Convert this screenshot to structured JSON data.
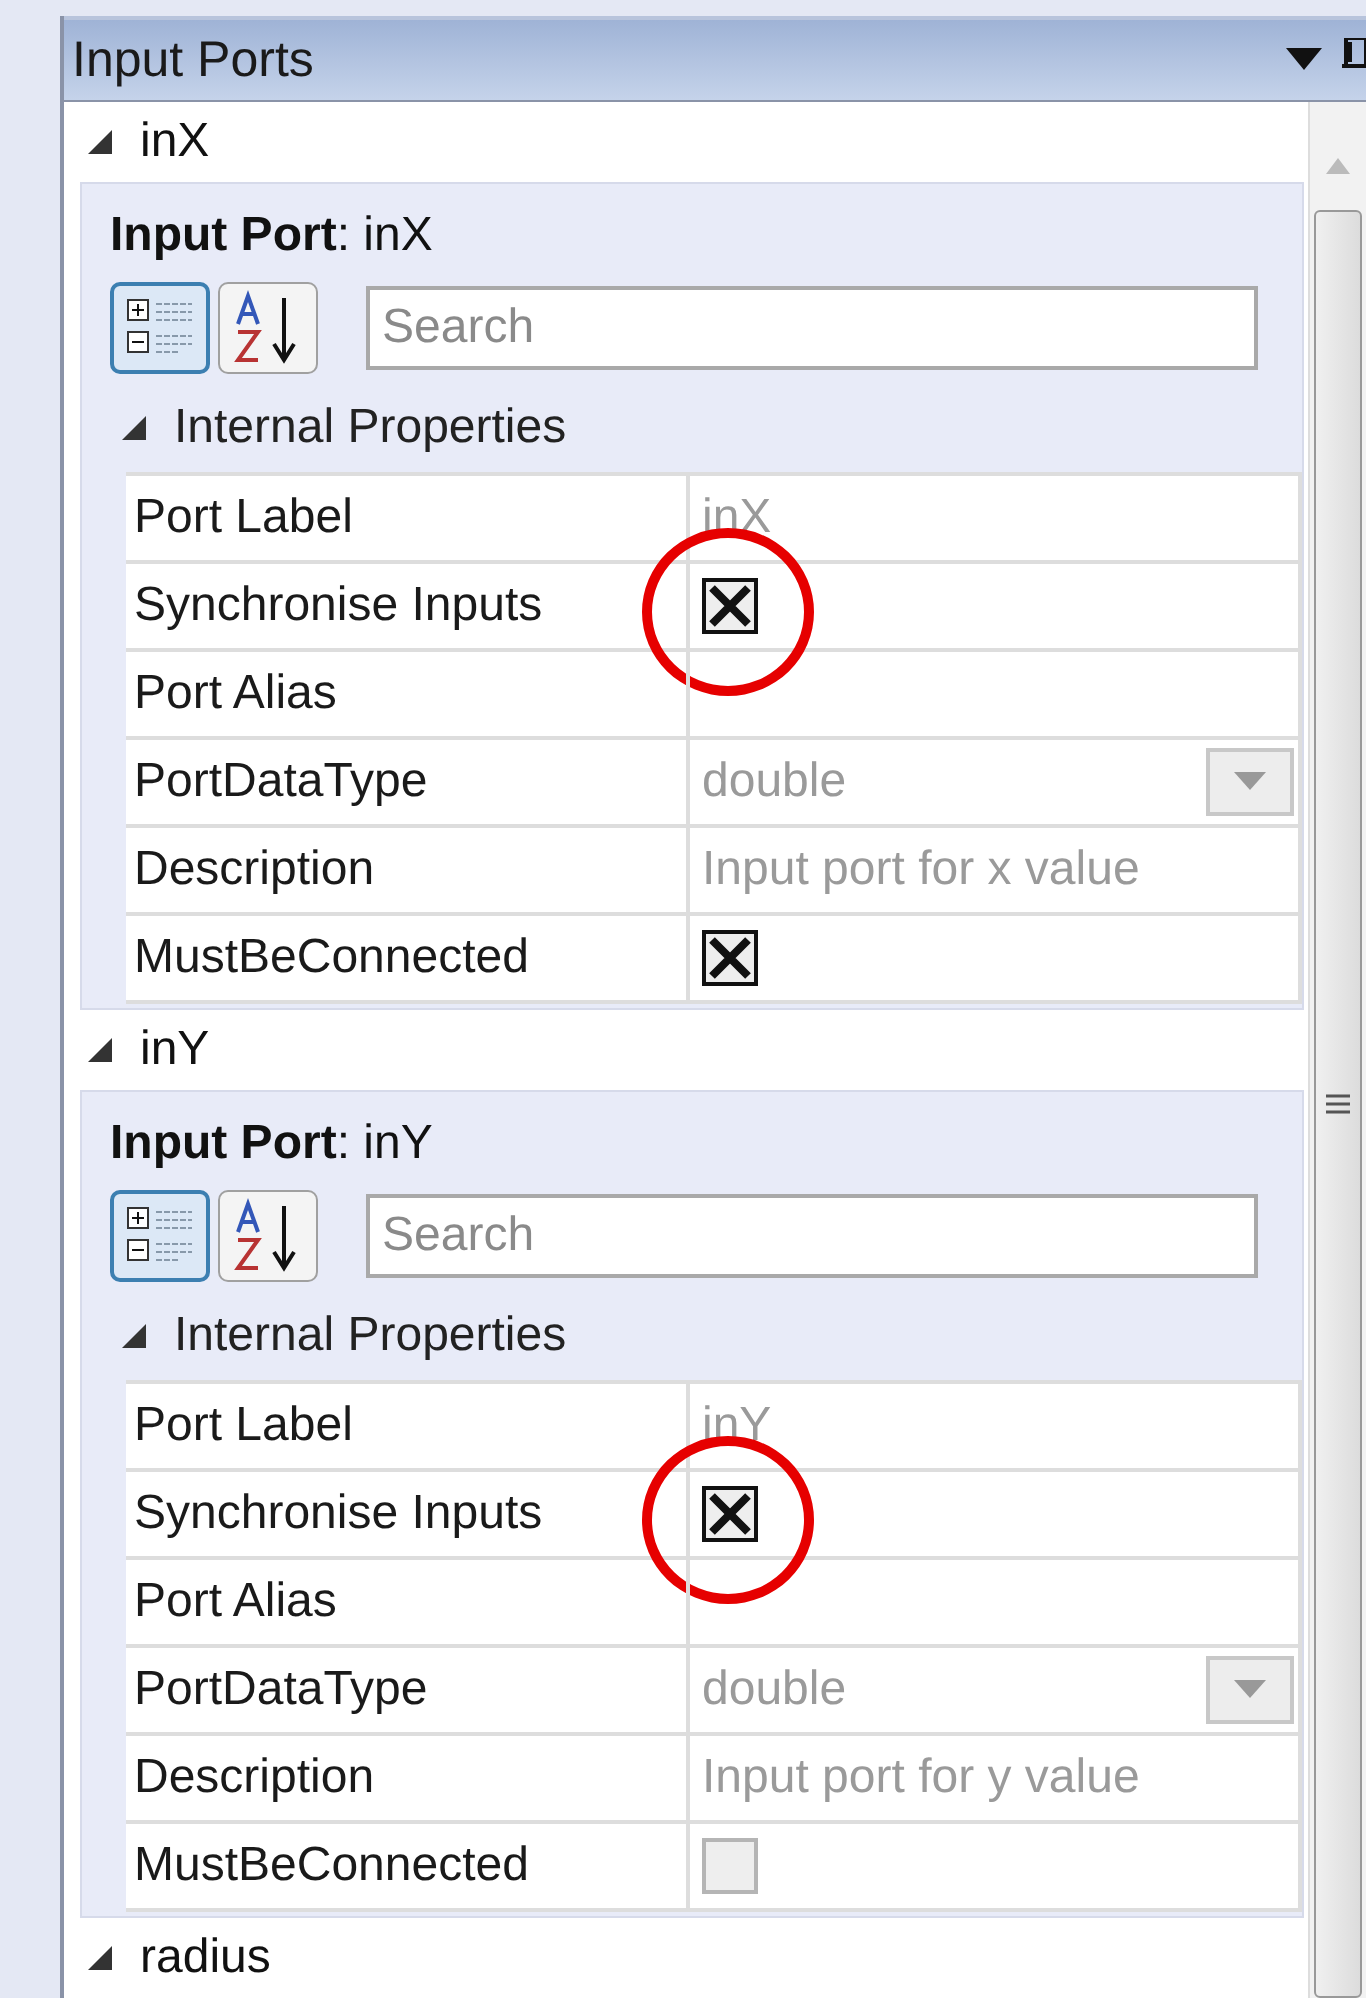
{
  "panel": {
    "title": "Input Ports"
  },
  "ports": [
    {
      "name": "inX",
      "expanded": true,
      "heading": "**Input Port**: inX",
      "search": {
        "placeholder": "Search"
      },
      "category": {
        "label": "Internal Properties",
        "expanded": true
      },
      "properties": [
        {
          "kind": "text",
          "label": "Port Label",
          "value": "inX",
          "highlighted": false
        },
        {
          "kind": "checkbox",
          "label": "Synchronise Inputs",
          "checked": true,
          "highlighted": true
        },
        {
          "kind": "text",
          "label": "Port Alias",
          "highlighted": false
        },
        {
          "kind": "dropdown",
          "label": "PortDataType",
          "value": "double",
          "highlighted": false
        },
        {
          "kind": "text",
          "label": "Description",
          "value": "Input port for x value",
          "highlighted": false
        },
        {
          "kind": "checkbox",
          "label": "MustBeConnected",
          "checked": true,
          "highlighted": false
        }
      ]
    },
    {
      "name": "inY",
      "expanded": true,
      "heading": "**Input Port**: inY",
      "search": {
        "placeholder": "Search"
      },
      "category": {
        "label": "Internal Properties",
        "expanded": true
      },
      "properties": [
        {
          "kind": "text",
          "label": "Port Label",
          "value": "inY",
          "highlighted": false
        },
        {
          "kind": "checkbox",
          "label": "Synchronise Inputs",
          "checked": true,
          "highlighted": true
        },
        {
          "kind": "text",
          "label": "Port Alias",
          "highlighted": false
        },
        {
          "kind": "dropdown",
          "label": "PortDataType",
          "value": "double",
          "highlighted": false
        },
        {
          "kind": "text",
          "label": "Description",
          "value": "Input port for y value",
          "highlighted": false
        },
        {
          "kind": "checkbox",
          "label": "MustBeConnected",
          "checked": false,
          "highlighted": false
        }
      ]
    },
    {
      "name": "radius",
      "expanded": true
    }
  ]
}
